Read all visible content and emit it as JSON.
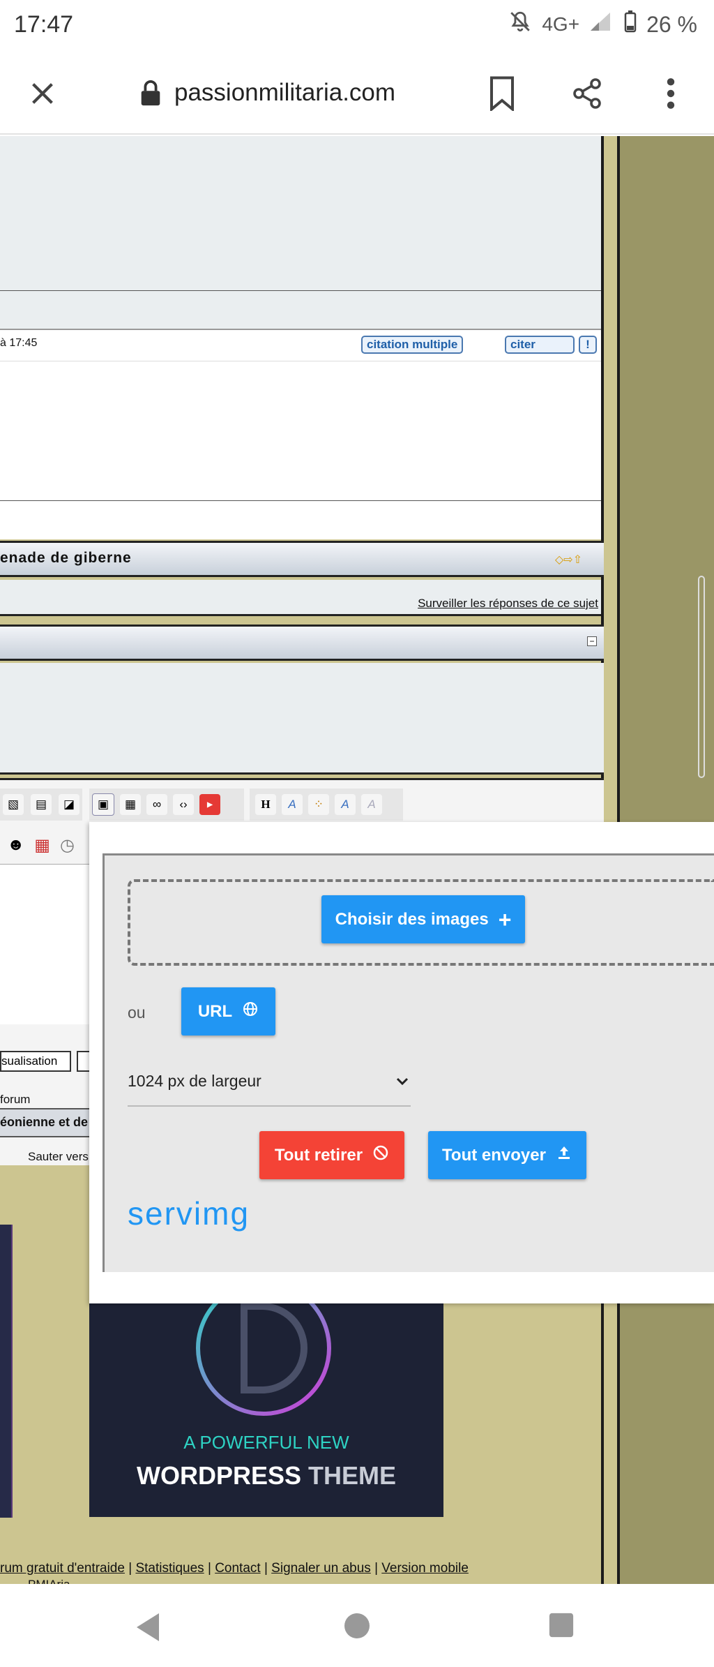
{
  "statusbar": {
    "time": "17:47",
    "network": "4G+",
    "battery": "26 %"
  },
  "browser": {
    "url": "passionmilitaria.com"
  },
  "post": {
    "time": "à 17:45",
    "multi_quote": "citation multiple",
    "quote": "citer"
  },
  "topic": {
    "title": "enade de giberne",
    "watch_link": "Surveiller les réponses de ce sujet"
  },
  "editor": {
    "preview_button": "sualisation",
    "forum_text": "forum",
    "category_text": "éonienne et de l",
    "jump_text": "Sauter vers"
  },
  "servimg": {
    "choose_images": "Choisir des images",
    "or_label": "ou",
    "url_button": "URL",
    "width_select": "1024 px de largeur",
    "remove_all": "Tout retirer",
    "send_all": "Tout envoyer",
    "logo": "servimg"
  },
  "ad": {
    "tagline": "A POWERFUL NEW",
    "title_a": "WORDPRESS",
    "title_b": "THEME"
  },
  "footer": {
    "link1": "rum gratuit d'entraide",
    "link2": "Statistiques",
    "link3": "Contact",
    "link4": "Signaler un abus",
    "link5": "Version mobile",
    "sep": "|",
    "bottom": "PMIAria"
  },
  "colors": {
    "accent": "#2196f3",
    "danger": "#f44336",
    "page_bg": "#ccc590",
    "sidebar": "#9a9666"
  }
}
